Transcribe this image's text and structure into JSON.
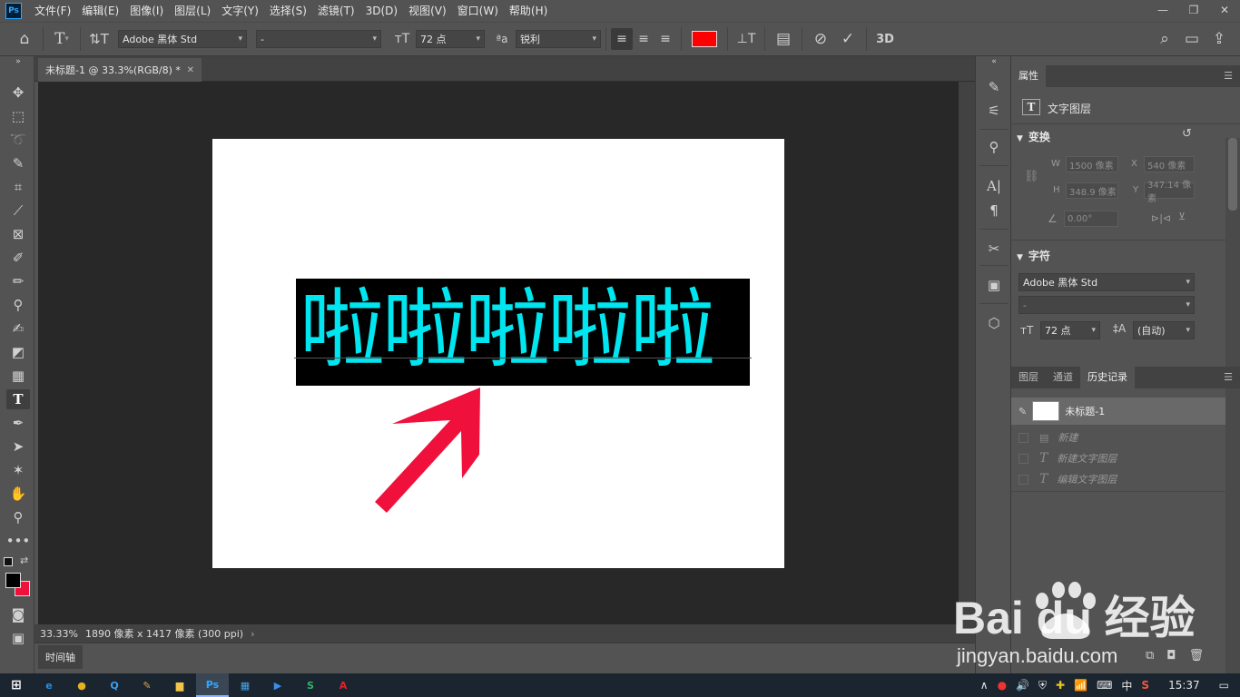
{
  "app": {
    "logo": "Ps"
  },
  "menu": [
    "文件(F)",
    "编辑(E)",
    "图像(I)",
    "图层(L)",
    "文字(Y)",
    "选择(S)",
    "滤镜(T)",
    "3D(D)",
    "视图(V)",
    "窗口(W)",
    "帮助(H)"
  ],
  "window_controls": {
    "minimize": "—",
    "restore": "❐",
    "close": "✕"
  },
  "options": {
    "font_family": "Adobe 黑体 Std",
    "font_style": "-",
    "font_size": "72 点",
    "antialias": "锐利",
    "text_color": "#ff0000",
    "three_d": "3D"
  },
  "document": {
    "tab_title": "未标题-1 @ 33.3%(RGB/8) *",
    "canvas_text": "啦啦啦啦啦",
    "text_color": "#00e6f0",
    "arrow_color": "#f0103c"
  },
  "status": {
    "zoom": "33.33%",
    "info": "1890 像素 x 1417 像素 (300 ppi)"
  },
  "timeline": {
    "tab": "时间轴"
  },
  "properties": {
    "tab": "属性",
    "layer_type": "文字图层",
    "transform_title": "变换",
    "w_label": "W",
    "w_value": "1500 像素",
    "x_label": "X",
    "x_value": "540 像素",
    "h_label": "H",
    "h_value": "348.9 像素",
    "y_label": "Y",
    "y_value": "347.14 像素",
    "angle": "0.00°",
    "char_title": "字符",
    "char_font": "Adobe 黑体 Std",
    "char_style": "-",
    "char_size": "72 点",
    "leading": "(自动)"
  },
  "history_panel": {
    "tabs": [
      "图层",
      "通道",
      "历史记录"
    ],
    "snapshot": "未标题-1",
    "items": [
      "新建",
      "新建文字图层",
      "编辑文字图层"
    ]
  },
  "taskbar": {
    "time": "15:37",
    "ime": "中",
    "apps": [
      {
        "name": "ie",
        "label": "e",
        "color": "#2a8fe0"
      },
      {
        "name": "chrome",
        "label": "●",
        "color": "#e8b21f"
      },
      {
        "name": "qq-browser",
        "label": "Q",
        "color": "#3aa0f0"
      },
      {
        "name": "tool",
        "label": "✎",
        "color": "#d8a34a"
      },
      {
        "name": "folder",
        "label": "▆",
        "color": "#f3c44c"
      },
      {
        "name": "photoshop",
        "label": "Ps",
        "color": "#31a8ff"
      },
      {
        "name": "store",
        "label": "▦",
        "color": "#4aa3e8"
      },
      {
        "name": "media-player",
        "label": "▶",
        "color": "#3c8ee8"
      },
      {
        "name": "wps-sheet",
        "label": "S",
        "color": "#2fb56b"
      },
      {
        "name": "acrobat",
        "label": "A",
        "color": "#e0232b"
      }
    ]
  },
  "watermark": {
    "brand": "Bai du 经验",
    "url": "jingyan.baidu.com"
  }
}
